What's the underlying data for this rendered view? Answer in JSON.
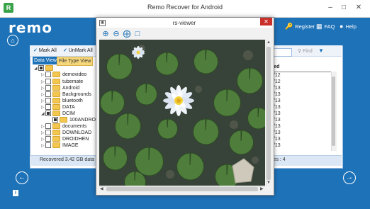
{
  "app": {
    "logo_glyph": "R",
    "title": "Remo Recover for Android",
    "brand": "remo",
    "win_minimize": "–",
    "win_maximize": "□",
    "win_close": "✕"
  },
  "topnav": {
    "register": "Register",
    "faq": "FAQ",
    "help": "Help"
  },
  "toolbar": {
    "mark_all": "Mark All",
    "unmark_all": "UnMark All",
    "find_placeholder": "Find"
  },
  "tabs": {
    "data_view": "Data View",
    "file_type_view": "File Type View"
  },
  "tree": {
    "items": [
      {
        "label": "demovideo"
      },
      {
        "label": "tubemate"
      },
      {
        "label": "Android"
      },
      {
        "label": "Backgrounds"
      },
      {
        "label": "bluetooth"
      },
      {
        "label": "DATA"
      },
      {
        "label": "DCIM"
      },
      {
        "label": "100ANDRO"
      },
      {
        "label": "documents"
      },
      {
        "label": "DOWNLOAD"
      },
      {
        "label": "DROIDHEN"
      },
      {
        "label": "IMAGE"
      }
    ]
  },
  "list": {
    "column_header": "ated",
    "dates": [
      "3/12",
      "3/12",
      "9/13",
      "9/13",
      "9/13",
      "9/13",
      "9/13",
      "9/13",
      "9/13",
      "9/13",
      "9/13",
      "9/13"
    ]
  },
  "status": {
    "recovered_text": "Recovered 3.42 GB data [18139",
    "right_text": "les : 4"
  },
  "viewer": {
    "title": "rs-viewer",
    "close_glyph": "✕",
    "tools": [
      "zoom-in-icon",
      "zoom-out-icon",
      "fit-icon",
      "fullscreen-icon"
    ]
  },
  "colors": {
    "app_blue": "#1e72b8",
    "close_red": "#c9302c",
    "folder_yellow": "#f3c64f",
    "tab_active": "#f7d77b"
  }
}
